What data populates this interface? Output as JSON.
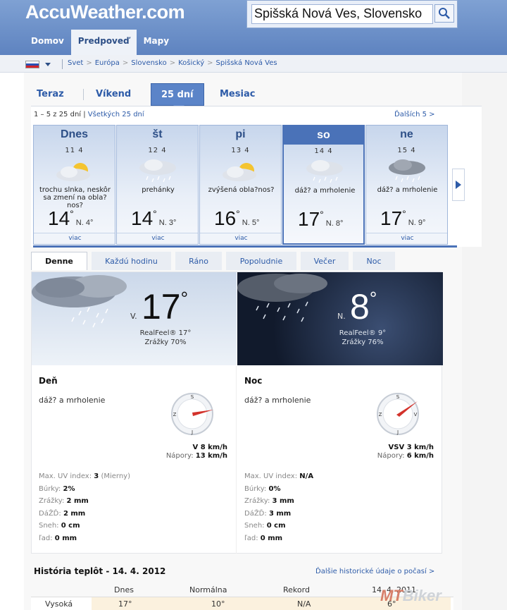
{
  "header": {
    "logo": "AccuWeather.com",
    "search_value": "Spišská Nová Ves, Slovensko",
    "nav": [
      "Domov",
      "Predpoveď",
      "Mapy"
    ]
  },
  "breadcrumb": [
    "Svet",
    "Európa",
    "Slovensko",
    "Košický",
    "Spišská Nová Ves"
  ],
  "tabs": [
    "Teraz",
    "Víkend",
    "25 dní",
    "Mesiac"
  ],
  "forecast": {
    "range_text": "1 – 5 z 25 dní",
    "all_link": "Všetkých 25 dní",
    "next_link": "Ďalších 5 >",
    "days": [
      {
        "name": "Dnes",
        "date": "11 4",
        "desc": "trochu slnka, neskôr sa zmení na obla?nos?",
        "high": "14",
        "low": "N. 4°",
        "more": "viac",
        "icon": "sun-cloud"
      },
      {
        "name": "št",
        "date": "12 4",
        "desc": "prehánky",
        "high": "14",
        "low": "N. 3°",
        "more": "viac",
        "icon": "rain-cloud"
      },
      {
        "name": "pi",
        "date": "13 4",
        "desc": "zvýšená obla?nos?",
        "high": "16",
        "low": "N. 5°",
        "more": "viac",
        "icon": "sun-cloud"
      },
      {
        "name": "so",
        "date": "14 4",
        "desc": "dáž? a mrholenie",
        "high": "17",
        "low": "N. 8°",
        "more": "",
        "icon": "rain-cloud"
      },
      {
        "name": "ne",
        "date": "15 4",
        "desc": "dáž? a mrholenie",
        "high": "17",
        "low": "N. 9°",
        "more": "viac",
        "icon": "dark-rain-cloud"
      }
    ]
  },
  "detail_tabs": [
    "Denne",
    "Každú hodinu",
    "Ráno",
    "Popoludnie",
    "Večer",
    "Noc"
  ],
  "day_banner": {
    "prefix": "V.",
    "temp": "17",
    "realfeel": "RealFeel® 17°",
    "precip": "Zrážky 70%"
  },
  "night_banner": {
    "prefix": "N.",
    "temp": "8",
    "realfeel": "RealFeel® 9°",
    "precip": "Zrážky 76%"
  },
  "day": {
    "title": "Deň",
    "desc": "dáž? a mrholenie",
    "wind": "V 8 km/h",
    "gust_label": "Nápory:",
    "gust": "13 km/h",
    "stats": [
      {
        "label": "Max. UV index:",
        "value": "3",
        "extra": "(Mierny)"
      },
      {
        "label": "Búrky:",
        "value": "2%",
        "extra": ""
      },
      {
        "label": "Zrážky:",
        "value": "2 mm",
        "extra": ""
      },
      {
        "label": "DáŽĎ:",
        "value": "2 mm",
        "extra": ""
      },
      {
        "label": "Sneh:",
        "value": "0 cm",
        "extra": ""
      },
      {
        "label": "ľad:",
        "value": "0 mm",
        "extra": ""
      }
    ]
  },
  "night": {
    "title": "Noc",
    "desc": "dáž? a mrholenie",
    "wind": "VSV 3 km/h",
    "gust_label": "Nápory:",
    "gust": "6 km/h",
    "stats": [
      {
        "label": "Max. UV index:",
        "value": "N/A",
        "extra": ""
      },
      {
        "label": "Búrky:",
        "value": "0%",
        "extra": ""
      },
      {
        "label": "Zrážky:",
        "value": "3 mm",
        "extra": ""
      },
      {
        "label": "DáŽĎ:",
        "value": "3 mm",
        "extra": ""
      },
      {
        "label": "Sneh:",
        "value": "0 cm",
        "extra": ""
      },
      {
        "label": "ľad:",
        "value": "0 mm",
        "extra": ""
      }
    ]
  },
  "compass": {
    "n": "S",
    "s": "J",
    "w": "Z",
    "e": "V"
  },
  "history": {
    "title": "História teplôt - 14. 4. 2012",
    "link": "Ďalšie historické údaje o počasí >",
    "headers": [
      "Dnes",
      "Normálna",
      "Rekord",
      "14. 4. 2011"
    ],
    "row_label": "Vysoká",
    "row_values": [
      "17°",
      "10°",
      "N/A",
      "6°"
    ]
  },
  "watermark": {
    "left": "MT",
    "right": "Biker"
  }
}
